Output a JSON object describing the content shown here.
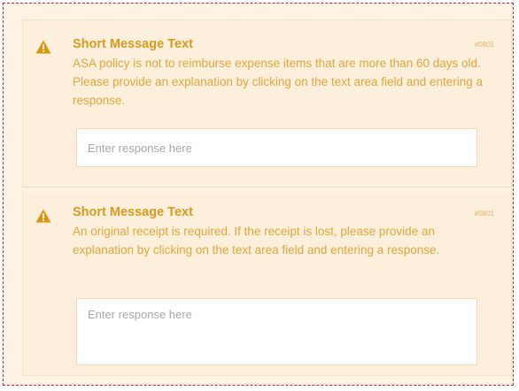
{
  "messages": [
    {
      "title": "Short Message Text",
      "code": "#0801",
      "body": "ASA policy is not to reimburse expense items that are more than 60 days old. Please provide an explanation by clicking on the text area field and entering a response.",
      "input_placeholder": "Enter response here",
      "icon": "warning-icon"
    },
    {
      "title": "Short Message Text",
      "code": "#0801",
      "body": "An original receipt is required. If the receipt is lost, please provide an explanation by clicking on the text area field and entering a response.",
      "input_placeholder": "Enter response here",
      "icon": "warning-icon"
    }
  ],
  "colors": {
    "accent": "#d79a1e",
    "body_text": "#e0a63a",
    "panel_bg": "#fdf2e3",
    "frame_border": "#c1272d"
  }
}
